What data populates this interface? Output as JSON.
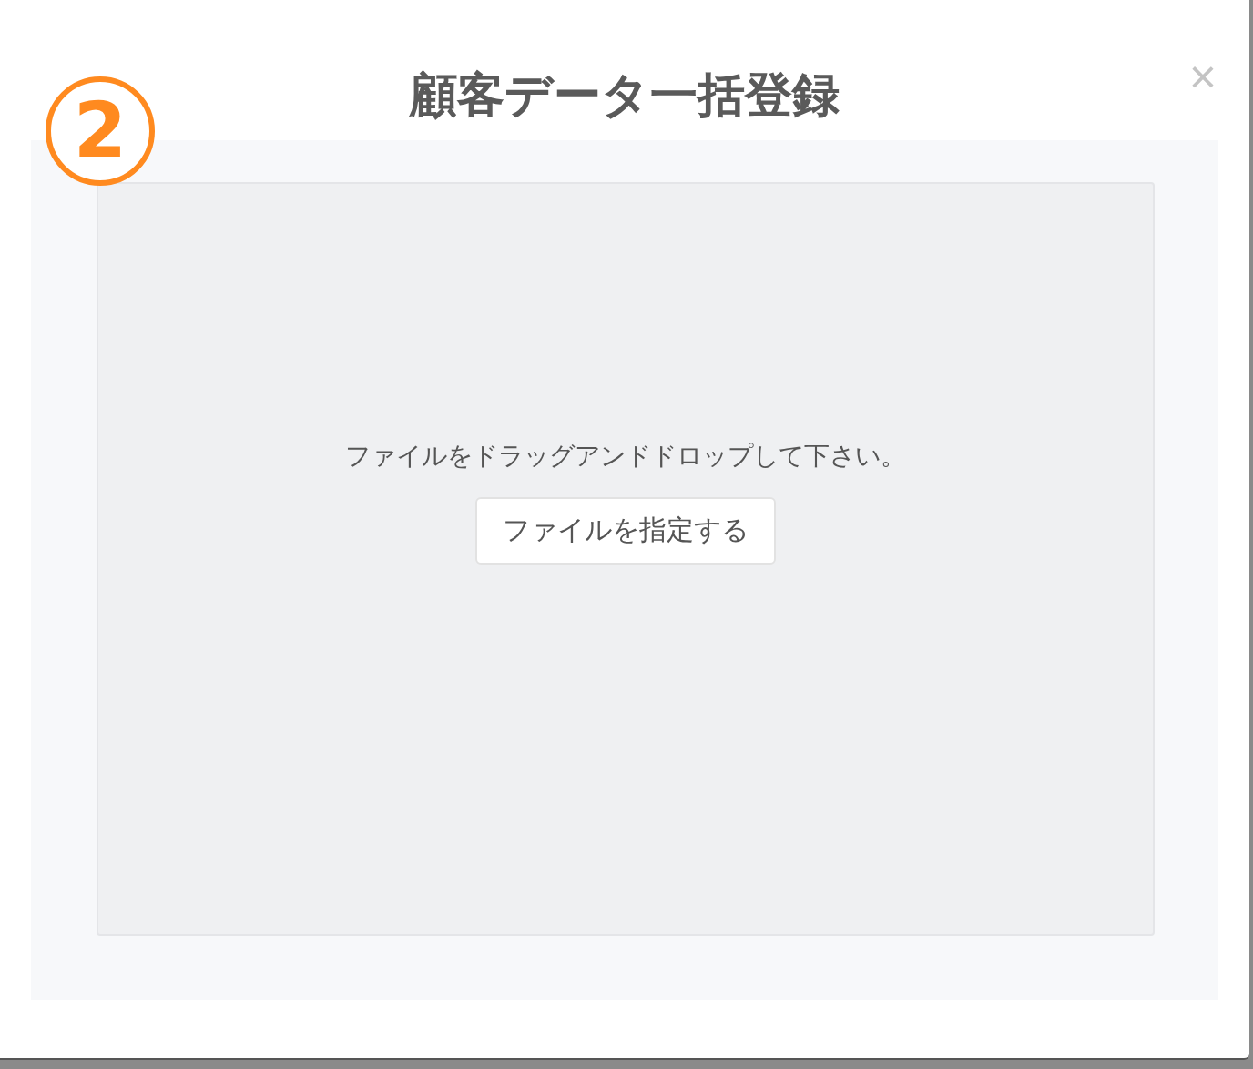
{
  "modal": {
    "step_badge": "2",
    "title": "顧客データ一括登録",
    "close": "×"
  },
  "dropzone": {
    "message": "ファイルをドラッグアンドドロップして下さい。",
    "button": "ファイルを指定する"
  }
}
